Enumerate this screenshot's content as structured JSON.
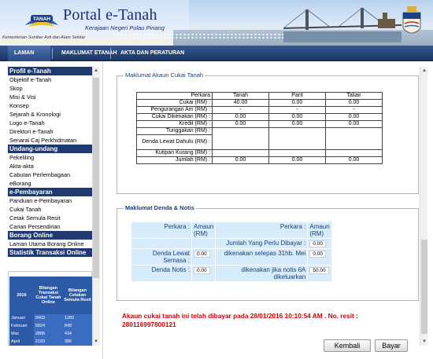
{
  "header": {
    "logo_text": "TANAH",
    "title": "Portal e-Tanah",
    "subtitle": "Kerajaan Negeri Pulau Pinang",
    "tagline": "Kementerian Sumber Asli dan Alam Sekitar"
  },
  "nav": {
    "home": "LAMAN UTAMA",
    "info": "MAKLUMAT ETANAH",
    "law": "AKTA DAN PERATURAN"
  },
  "sidebar": {
    "sections": [
      {
        "title": "Profil e-Tanah",
        "items": [
          "Objektif e-Tanah",
          "Skop",
          "Misi & Visi",
          "Konsep",
          "Sejarah & Kronologi",
          "Logo e-Tanah",
          "Direktori e-Tanah",
          "Senarai Caj Perkhidmatan"
        ]
      },
      {
        "title": "Undang-undang",
        "items": [
          "Pekeliling",
          "Akta-akta",
          "Cabutan Perlembagaan",
          "eBorang"
        ]
      },
      {
        "title": "e-Pembayaran",
        "items": [
          "Panduan e-Pembayaran",
          "Cukai Tanah",
          "Cetak Semula Resit",
          "Carian Persendirian"
        ]
      },
      {
        "title": "Borang Online",
        "items": [
          "Laman Utama Borang Online"
        ]
      },
      {
        "title": "Statistik Transaksi Online",
        "items": []
      }
    ],
    "stats": {
      "year": "2016",
      "col1": "Bilangan Transaksi Cukai Tanah Online",
      "col2": "Bilangan Cetakan Semula Resit",
      "rows": [
        {
          "month": "Januari",
          "a": "9403",
          "b": "1282"
        },
        {
          "month": "Februari",
          "a": "5824",
          "b": "849"
        },
        {
          "month": "Mac",
          "a": "2806",
          "b": "434"
        },
        {
          "month": "April",
          "a": "2183",
          "b": "386"
        }
      ]
    }
  },
  "cukai": {
    "legend": "Maklumat Akaun Cukai Tanah",
    "headers": [
      "Perkara",
      "Tanah",
      "Parit",
      "Taliair"
    ],
    "rows": [
      {
        "label": "Cukai (RM) :",
        "tanah": "40.00",
        "parit": "0.00",
        "taliair": "0.00"
      },
      {
        "label": "Pengurangan Am (RM) :",
        "tanah": "-",
        "parit": "-",
        "taliair": "-"
      },
      {
        "label": "Cukai Dikenakan (RM) :",
        "tanah": "0.00",
        "parit": "0.00",
        "taliair": "0.00"
      },
      {
        "label": "Kredit (RM) :",
        "tanah": "0.00",
        "parit": "0.00",
        "taliair": "0.00"
      },
      {
        "label": "Tunggakan (RM) :",
        "tanah": "",
        "parit": "",
        "taliair": ""
      },
      {
        "label": "Denda Lewat Dahulu (RM) :",
        "tanah": "",
        "parit": "",
        "taliair": ""
      },
      {
        "label": "Kutipan Kurang (RM) :",
        "tanah": "",
        "parit": "",
        "taliair": ""
      },
      {
        "label": "Jumlah (RM) :",
        "tanah": "0.00",
        "parit": "0.00",
        "taliair": "0.00"
      }
    ]
  },
  "denda": {
    "legend": "Maklumat Denda & Notis",
    "h_left": "Perkara :",
    "h_left_amt": "Amaun (RM)",
    "h_right": "Perkara :",
    "h_right_amt": "Amaun (RM)",
    "jumlah_label": "Jumlah Yang Perlu Dibayar :",
    "jumlah_value": "0.00",
    "lewat_label": "Denda Lewat Semasa :",
    "lewat_value": "0.00",
    "selepas_label": "dikenakan selepas 31hb. Mei",
    "selepas_value": "0.00",
    "notis_label": "Denda Notis :",
    "notis_value": "0.00",
    "notis6a_label": "dikenakan jika notis 6A dikeluarkan",
    "notis6a_value": "50.00"
  },
  "message": "Akaun cukai tanah ini telah dibayar pada 28/01/2016 10:10:54 AM . No. resit : 280116997800121",
  "buttons": {
    "back": "Kembali",
    "pay": "Bayar"
  },
  "colors": {
    "nav": "#1c3763",
    "section_head": "#1e3a6e",
    "warning": "#d40000",
    "denda_cell": "#d6ecfa"
  }
}
